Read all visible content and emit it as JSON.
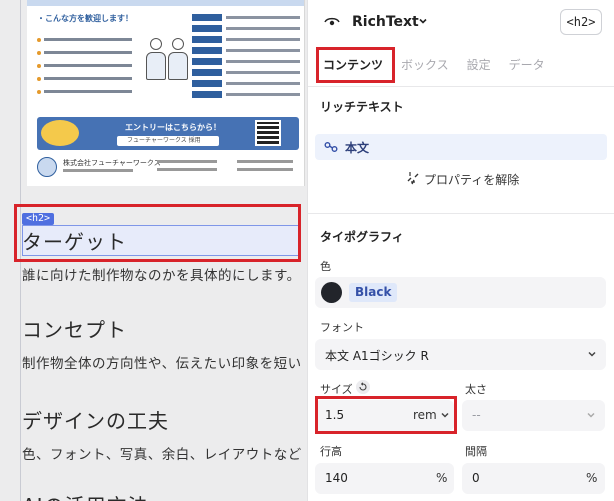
{
  "canvas": {
    "flyer": {
      "heading": "・こんな方を歓迎します！",
      "entry_title": "エントリーはこちらから！",
      "entry_search": "フューチャーワークス 採用",
      "company": "株式会社フューチャーワークス"
    },
    "h2_badge": "<h2>",
    "headings": [
      "ターゲット",
      "コンセプト",
      "デザインの工夫",
      "AIの活用方法"
    ],
    "paragraphs": [
      "誰に向けた制作物なのかを具体的にします。",
      "制作物全体の方向性や、伝えたい印象を短い",
      "色、フォント、写真、余白、レイアウトなど"
    ]
  },
  "panel": {
    "title": "RichText",
    "tag_button": "<h2>",
    "tabs": [
      "コンテンツ",
      "ボックス",
      "設定",
      "データ"
    ],
    "richtext_section": "リッチテキスト",
    "linked_field": "本文",
    "unlink_label": "プロパティを解除",
    "typography_section": "タイポグラフィ",
    "color_label": "色",
    "color_value": "Black",
    "color_hex": "#22252b",
    "font_label": "フォント",
    "font_value": "本文 A1ゴシック R",
    "size_label": "サイズ",
    "size_value": "1.5",
    "size_unit": "rem",
    "weight_label": "太さ",
    "weight_value": "--",
    "line_height_label": "行高",
    "line_height_value": "140",
    "line_height_unit": "%",
    "spacing_label": "間隔",
    "spacing_value": "0",
    "spacing_unit": "%"
  },
  "colors": {
    "accent": "#4f6fe0",
    "highlight": "#d8232a"
  }
}
